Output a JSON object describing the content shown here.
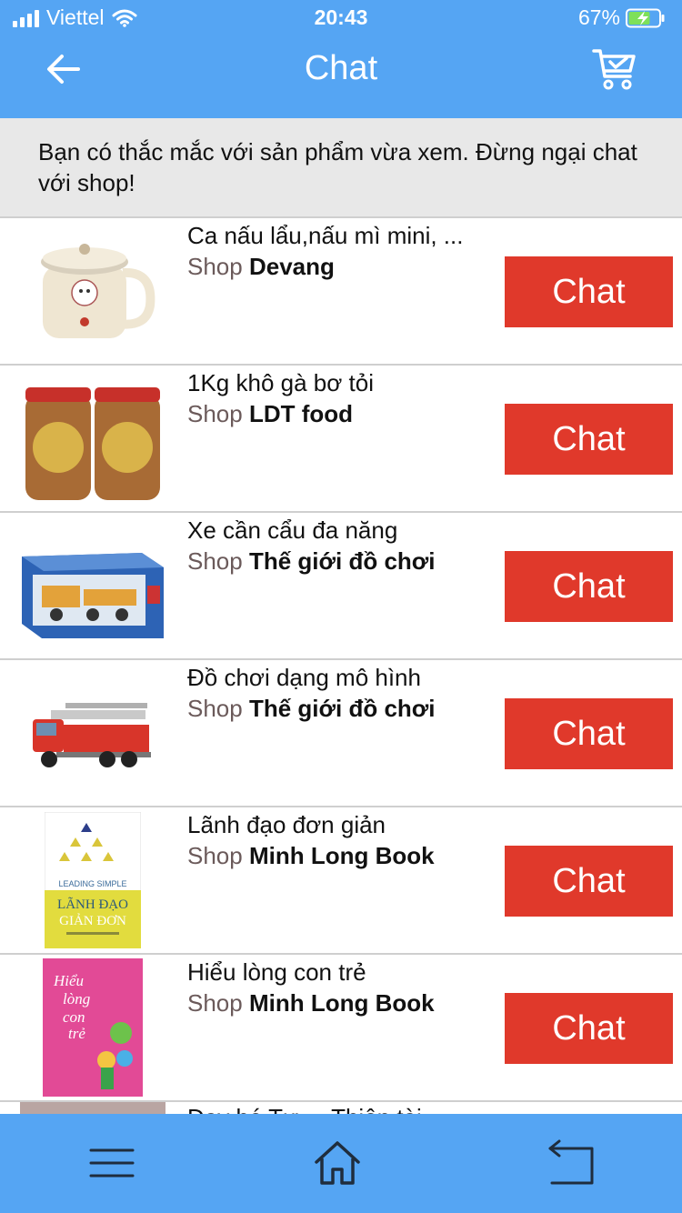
{
  "status_bar": {
    "carrier": "Viettel",
    "time": "20:43",
    "battery": "67%"
  },
  "header": {
    "title": "Chat",
    "back_icon": "back-arrow-icon",
    "cart_icon": "cart-icon"
  },
  "notice": {
    "text": "Bạn có thắc mắc với sản phẩm vừa xem. Đừng ngại chat với shop!"
  },
  "products": [
    {
      "name": "Ca nấu lẩu,nấu mì mini, ...",
      "shop_prefix": "Shop",
      "shop": "Devang",
      "chat_label": "Chat"
    },
    {
      "name": "1Kg khô gà bơ tỏi",
      "shop_prefix": "Shop",
      "shop": "LDT food",
      "chat_label": "Chat"
    },
    {
      "name": "Xe cần cẩu đa năng",
      "shop_prefix": "Shop",
      "shop": "Thế giới đồ chơi",
      "chat_label": "Chat"
    },
    {
      "name": "Đồ chơi dạng mô hình",
      "shop_prefix": "Shop",
      "shop": "Thế giới đồ chơi",
      "chat_label": "Chat"
    },
    {
      "name": "Lãnh đạo đơn giản",
      "shop_prefix": "Shop",
      "shop": "Minh Long Book",
      "chat_label": "Chat"
    },
    {
      "name": "Hiểu lòng con trẻ",
      "shop_prefix": "Shop",
      "shop": "Minh Long Book",
      "chat_label": "Chat"
    }
  ],
  "partial_item": {
    "name": "Dạy bé Tự ... Thiên tài"
  },
  "book_covers": {
    "leading_simple_small": "LEADING SIMPLE",
    "leading_simple_title_1": "LÃNH ĐẠO",
    "leading_simple_title_2": "GIẢN ĐƠN",
    "hieu_long_1": "Hiểu",
    "hieu_long_2": "lòng",
    "hieu_long_3": "con",
    "hieu_long_4": "trẻ"
  },
  "bottom_bar": {
    "menu_icon": "menu-icon",
    "home_icon": "home-icon",
    "return_icon": "return-icon"
  },
  "colors": {
    "primary": "#55a5f3",
    "chat_button": "#e0392b",
    "notice_bg": "#e8e8e8"
  }
}
